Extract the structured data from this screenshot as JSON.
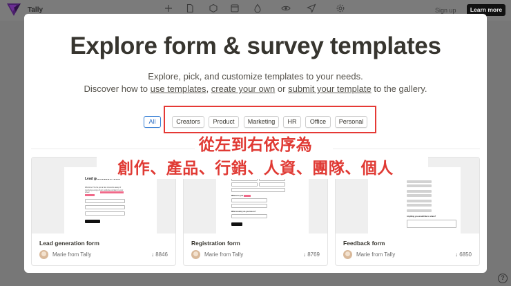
{
  "app": {
    "brand": "Tally",
    "signup": "Sign up",
    "learn_more": "Learn more",
    "help": "?"
  },
  "toolbar_icons": [
    "plus-icon",
    "file-icon",
    "hexagon-icon",
    "layout-icon",
    "drop-icon",
    "eye-icon",
    "send-icon",
    "gear-icon"
  ],
  "modal": {
    "title": "Explore form & survey templates",
    "subtitle1": "Explore, pick, and customize templates to your needs.",
    "subtitle2_pre": "Discover how to ",
    "link_use": "use templates",
    "subtitle2_sep1": ", ",
    "link_create": "create your own",
    "subtitle2_sep2": " or ",
    "link_submit": "submit your template",
    "subtitle2_post": " to the gallery.",
    "filters": [
      "All",
      "Creators",
      "Product",
      "Marketing",
      "HR",
      "Office",
      "Personal"
    ],
    "active_filter": "All"
  },
  "annotation": {
    "line1": "從左到右依序為",
    "line2": "創作、產品、行銷、人資、團隊、個人",
    "color": "#e03a34"
  },
  "cards": [
    {
      "title": "Lead generation form",
      "author": "Marie from Tally",
      "downloads": "↓ 8846",
      "preview": {
        "heading": "Lead generation form",
        "text": "Welcome! You're just a few moments away of receiving a copy of our exclusive content in your inbox!"
      }
    },
    {
      "title": "Registration form",
      "author": "Marie from Tally",
      "downloads": "↓ 8769",
      "preview": {
        "heading": "Let's start with your personal details",
        "q1": "Where do you work?",
        "q2": "What country do you live in?"
      }
    },
    {
      "title": "Feedback form",
      "author": "Marie from Tally",
      "downloads": "↓ 6850",
      "preview": {
        "heading": "Thanks for using Tally",
        "q1": "How would you rate us?",
        "q2": "Anything you would like to share?"
      }
    }
  ]
}
